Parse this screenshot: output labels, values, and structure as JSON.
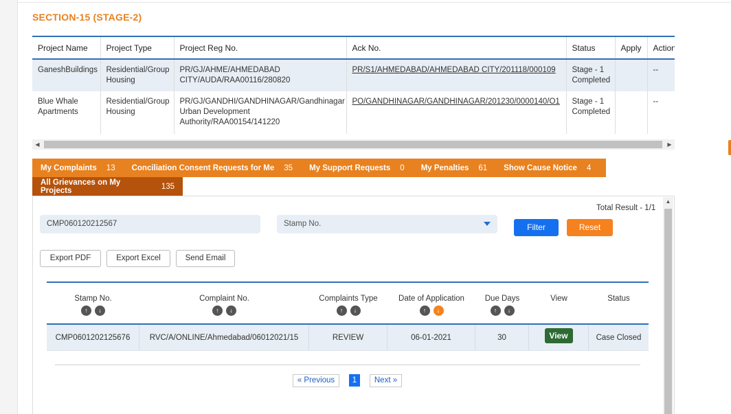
{
  "section_title": "SECTION-15 (STAGE-2)",
  "project_table": {
    "headers": [
      "Project Name",
      "Project Type",
      "Project Reg No.",
      "Ack No.",
      "Status",
      "Apply",
      "Action"
    ],
    "rows": [
      {
        "name": "GaneshBuildings",
        "type": "Residential/Group Housing",
        "reg_no": "PR/GJ/AHME/AHMEDABAD CITY/AUDA/RAA00116/280820",
        "ack_no": "PR/S1/AHMEDABAD/AHMEDABAD CITY/201118/000109",
        "status": "Stage - 1 Completed",
        "apply": "",
        "action": "--"
      },
      {
        "name": "Blue Whale Apartments",
        "type": "Residential/Group Housing",
        "reg_no": "PR/GJ/GANDHI/GANDHINAGAR/Gandhinagar Urban Development Authority/RAA00154/141220",
        "ack_no": "PO/GANDHINAGAR/GANDHINAGAR/201230/0000140/O1",
        "status": "Stage - 1 Completed",
        "apply": "",
        "action": "--"
      }
    ]
  },
  "tabs": [
    {
      "label": "My Complaints",
      "count": "13"
    },
    {
      "label": "Conciliation Consent Requests for Me",
      "count": "35"
    },
    {
      "label": "My Support Requests",
      "count": "0"
    },
    {
      "label": "My Penalties",
      "count": "61"
    },
    {
      "label": "Show Cause Notice",
      "count": "4"
    }
  ],
  "active_tab": {
    "label": "All Grievances on My Projects",
    "count": "135"
  },
  "filters": {
    "total_result": "Total Result - 1/1",
    "complaint_value": "CMP060120212567",
    "stamp_placeholder": "Stamp No.",
    "filter_label": "Filter",
    "reset_label": "Reset"
  },
  "exports": {
    "pdf": "Export PDF",
    "excel": "Export Excel",
    "email": "Send Email"
  },
  "grievance_table": {
    "headers": [
      "Stamp No.",
      "Complaint No.",
      "Complaints Type",
      "Date of Application",
      "Due Days",
      "View",
      "Status"
    ],
    "rows": [
      {
        "stamp_no": "CMP0601202125676",
        "complaint_no": "RVC/A/ONLINE/Ahmedabad/06012021/15",
        "type": "REVIEW",
        "date": "06-01-2021",
        "due_days": "30",
        "view": "View",
        "status": "Case Closed"
      }
    ]
  },
  "pagination": {
    "previous": "« Previous",
    "page": "1",
    "next": "Next »"
  },
  "colors": {
    "accent_orange": "#e8811f",
    "active_tab": "#b5520b",
    "primary_blue": "#1570ef",
    "view_green": "#2e6b34",
    "header_line": "#2f6fb6"
  }
}
